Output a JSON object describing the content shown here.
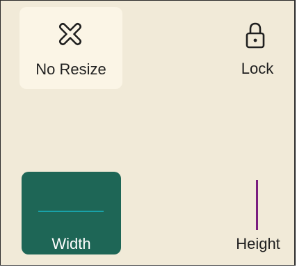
{
  "resize_options": {
    "no_resize": {
      "label": "No Resize",
      "icon": "no-resize-x-icon",
      "selected": false
    },
    "lock": {
      "label": "Lock",
      "icon": "padlock-icon"
    },
    "width": {
      "label": "Width",
      "icon": "horizontal-line-icon",
      "selected": true
    },
    "height": {
      "label": "Height",
      "icon": "vertical-line-icon"
    }
  },
  "colors": {
    "background": "#f1ead8",
    "no_resize_hover_bg": "#fbf5e6",
    "width_selected_bg": "#1e6656",
    "width_line": "#19a2a8",
    "height_line": "#7a1d7e",
    "text": "#1f1f1f"
  }
}
